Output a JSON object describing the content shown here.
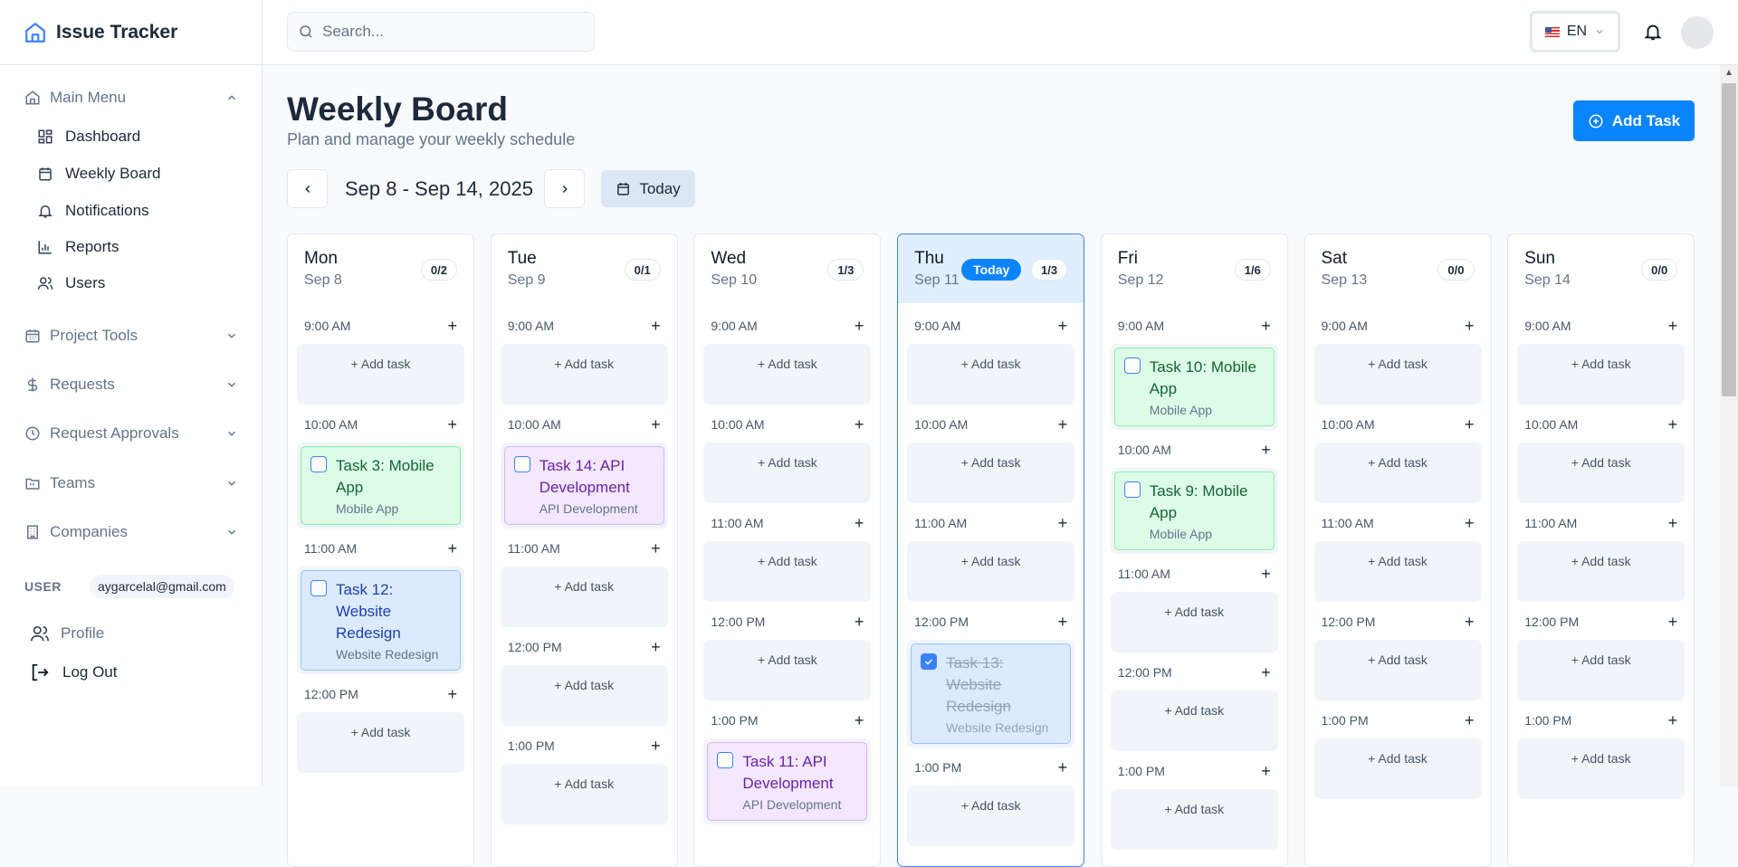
{
  "app": {
    "name": "Issue Tracker"
  },
  "sidebar": {
    "main_menu": "Main Menu",
    "items": [
      {
        "label": "Dashboard",
        "icon": "dashboard-icon"
      },
      {
        "label": "Weekly Board",
        "icon": "calendar-icon"
      },
      {
        "label": "Notifications",
        "icon": "bell-icon"
      },
      {
        "label": "Reports",
        "icon": "chart-icon"
      },
      {
        "label": "Users",
        "icon": "users-icon"
      }
    ],
    "groups": [
      {
        "label": "Project Tools",
        "icon": "calendar-grid-icon"
      },
      {
        "label": "Requests",
        "icon": "dollar-icon"
      },
      {
        "label": "Request Approvals",
        "icon": "clock-icon"
      },
      {
        "label": "Teams",
        "icon": "folder-icon"
      },
      {
        "label": "Companies",
        "icon": "building-icon"
      }
    ],
    "user_label": "USER",
    "email": "aygarcelal@gmail.com",
    "profile": "Profile",
    "logout": "Log Out"
  },
  "header": {
    "search_placeholder": "Search...",
    "language": "EN"
  },
  "page": {
    "title": "Weekly Board",
    "subtitle": "Plan and manage your weekly schedule",
    "add_task": "Add Task",
    "range": "Sep 8 - Sep 14, 2025",
    "today": "Today"
  },
  "board": {
    "add_task_label": "+ Add task",
    "today_badge": "Today",
    "days": [
      {
        "name": "Mon",
        "date": "Sep 8",
        "count": "0/2",
        "slots": [
          {
            "time": "9:00 AM"
          },
          {
            "time": "10:00 AM",
            "task": {
              "title": "Task 3: Mobile App",
              "project": "Mobile App",
              "color": "green",
              "done": false
            }
          },
          {
            "time": "11:00 AM",
            "task": {
              "title": "Task 12: Website Redesign",
              "project": "Website Redesign",
              "color": "blue",
              "done": false
            }
          },
          {
            "time": "12:00 PM"
          }
        ]
      },
      {
        "name": "Tue",
        "date": "Sep 9",
        "count": "0/1",
        "slots": [
          {
            "time": "9:00 AM"
          },
          {
            "time": "10:00 AM",
            "task": {
              "title": "Task 14: API Development",
              "project": "API Development",
              "color": "purple",
              "done": false
            }
          },
          {
            "time": "11:00 AM"
          },
          {
            "time": "12:00 PM"
          },
          {
            "time": "1:00 PM"
          }
        ]
      },
      {
        "name": "Wed",
        "date": "Sep 10",
        "count": "1/3",
        "slots": [
          {
            "time": "9:00 AM"
          },
          {
            "time": "10:00 AM"
          },
          {
            "time": "11:00 AM"
          },
          {
            "time": "12:00 PM"
          },
          {
            "time": "1:00 PM",
            "task": {
              "title": "Task 11: API Development",
              "project": "API Development",
              "color": "purple",
              "done": false
            }
          }
        ]
      },
      {
        "name": "Thu",
        "date": "Sep 11",
        "count": "1/3",
        "today": true,
        "slots": [
          {
            "time": "9:00 AM"
          },
          {
            "time": "10:00 AM"
          },
          {
            "time": "11:00 AM"
          },
          {
            "time": "12:00 PM",
            "task": {
              "title": "Task 13: Website Redesign",
              "project": "Website Redesign",
              "color": "blue",
              "done": true
            }
          },
          {
            "time": "1:00 PM"
          }
        ]
      },
      {
        "name": "Fri",
        "date": "Sep 12",
        "count": "1/6",
        "slots": [
          {
            "time": "9:00 AM",
            "task": {
              "title": "Task 10: Mobile App",
              "project": "Mobile App",
              "color": "green",
              "done": false
            }
          },
          {
            "time": "10:00 AM",
            "task": {
              "title": "Task 9: Mobile App",
              "project": "Mobile App",
              "color": "green",
              "done": false
            }
          },
          {
            "time": "11:00 AM"
          },
          {
            "time": "12:00 PM"
          },
          {
            "time": "1:00 PM"
          }
        ]
      },
      {
        "name": "Sat",
        "date": "Sep 13",
        "count": "0/0",
        "slots": [
          {
            "time": "9:00 AM"
          },
          {
            "time": "10:00 AM"
          },
          {
            "time": "11:00 AM"
          },
          {
            "time": "12:00 PM"
          },
          {
            "time": "1:00 PM"
          }
        ]
      },
      {
        "name": "Sun",
        "date": "Sep 14",
        "count": "0/0",
        "slots": [
          {
            "time": "9:00 AM"
          },
          {
            "time": "10:00 AM"
          },
          {
            "time": "11:00 AM"
          },
          {
            "time": "12:00 PM"
          },
          {
            "time": "1:00 PM"
          }
        ]
      }
    ]
  }
}
